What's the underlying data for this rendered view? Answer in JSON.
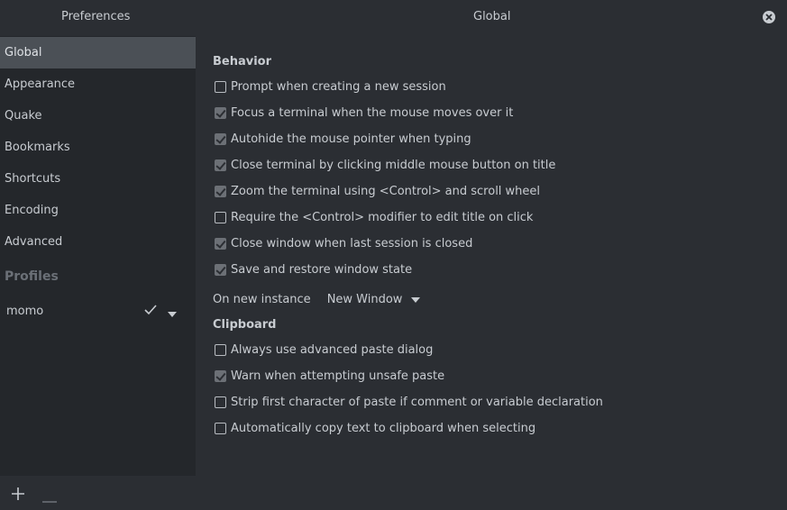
{
  "window": {
    "left_title": "Preferences",
    "center_title": "Global",
    "close_icon": "close-icon"
  },
  "sidebar": {
    "items": [
      {
        "label": "Global",
        "selected": true
      },
      {
        "label": "Appearance",
        "selected": false
      },
      {
        "label": "Quake",
        "selected": false
      },
      {
        "label": "Bookmarks",
        "selected": false
      },
      {
        "label": "Shortcuts",
        "selected": false
      },
      {
        "label": "Encoding",
        "selected": false
      },
      {
        "label": "Advanced",
        "selected": false
      }
    ],
    "profiles_heading": "Profiles",
    "profile": {
      "name": "momo",
      "default_icon": "check-icon",
      "menu_icon": "chevron-down-icon"
    },
    "add_icon": "plus-icon",
    "remove_icon": "minus-icon"
  },
  "behavior": {
    "title": "Behavior",
    "options": [
      {
        "label": "Prompt when creating a new session",
        "checked": false
      },
      {
        "label": "Focus a terminal when the mouse moves over it",
        "checked": true
      },
      {
        "label": "Autohide the mouse pointer when typing",
        "checked": true
      },
      {
        "label": "Close terminal by clicking middle mouse button on title",
        "checked": true
      },
      {
        "label": "Zoom the terminal using <Control> and scroll wheel",
        "checked": true
      },
      {
        "label": "Require the <Control> modifier to edit title on click",
        "checked": false
      },
      {
        "label": "Close window when last session is closed",
        "checked": true
      },
      {
        "label": "Save and restore window state",
        "checked": true
      }
    ],
    "new_instance_label": "On new instance",
    "new_instance_value": "New Window"
  },
  "clipboard": {
    "title": "Clipboard",
    "options": [
      {
        "label": "Always use advanced paste dialog",
        "checked": false
      },
      {
        "label": "Warn when attempting unsafe paste",
        "checked": true
      },
      {
        "label": "Strip first character of paste if comment or variable declaration",
        "checked": false
      },
      {
        "label": "Automatically copy text to clipboard when selecting",
        "checked": false
      }
    ]
  },
  "colors": {
    "background": "#2b2e33",
    "sidebar": "#24272b",
    "selected": "#4b5056",
    "text": "#c8ccd1"
  }
}
